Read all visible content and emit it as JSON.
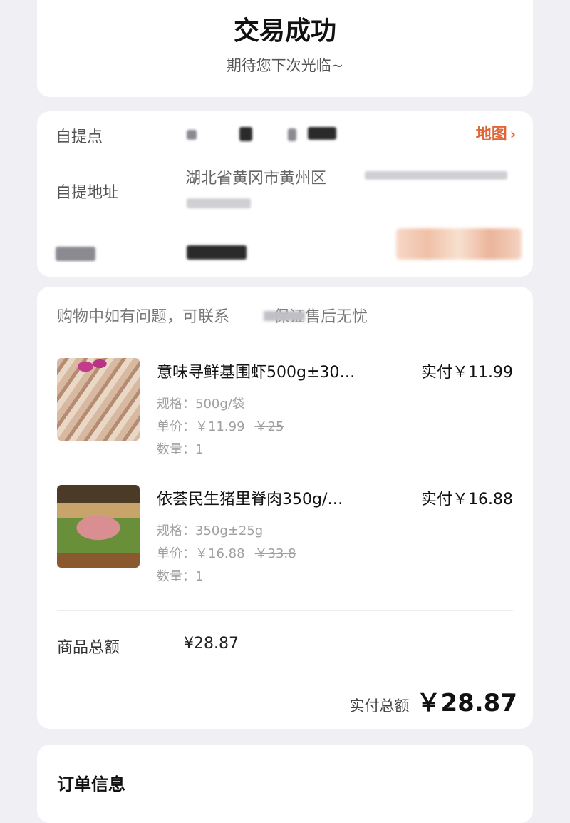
{
  "status": {
    "title": "交易成功",
    "subtitle": "期待您下次光临~"
  },
  "pickup": {
    "point_label": "自提点",
    "address_label": "自提地址",
    "map_link": "地图",
    "address_text": "湖北省黄冈市黄州区"
  },
  "order": {
    "hint_prefix": "购物中如有问题，可联系",
    "hint_suffix": "保证售后无忧",
    "items": [
      {
        "name": "意味寻鲜基围虾500g±30…",
        "paid": "实付￥11.99",
        "spec": "规格：500g/袋",
        "unit_price": "单价：￥11.99",
        "original_price": "￥25",
        "quantity": "数量：1"
      },
      {
        "name": "依荟民生猪里脊肉350g/…",
        "paid": "实付￥16.88",
        "spec": "规格：350g±25g",
        "unit_price": "单价：￥16.88",
        "original_price": "￥33.8",
        "quantity": "数量：1"
      }
    ],
    "subtotal_label": "商品总额",
    "subtotal_value": "¥28.87",
    "total_label": "实付总额",
    "total_value": "￥28.87"
  },
  "info": {
    "title": "订单信息"
  },
  "colors": {
    "accent": "#e0663a",
    "background": "#efeff4"
  }
}
